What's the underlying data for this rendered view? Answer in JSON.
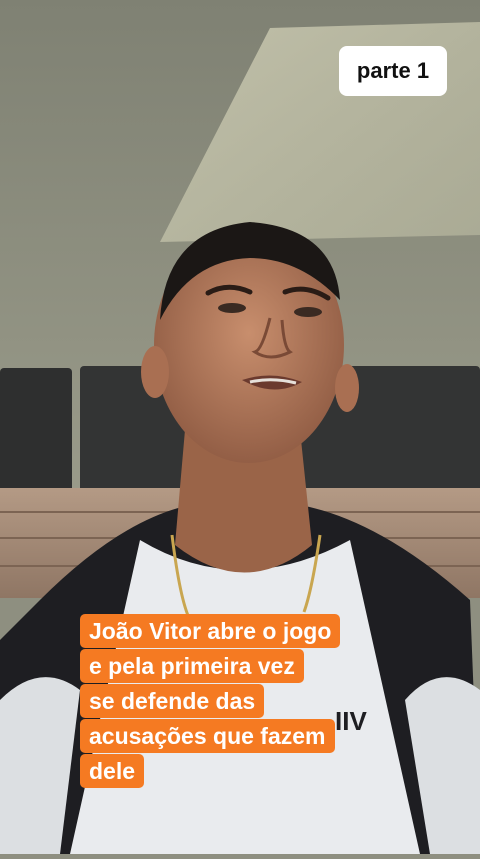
{
  "overlay": {
    "part_label": "parte 1",
    "caption_lines": [
      "João Vitor abre o jogo",
      "e pela primeira vez",
      "se defende das",
      "acusações que fazem",
      "dele"
    ],
    "caption_color": "#f57a22",
    "badge_color": "#ffffff"
  },
  "photo": {
    "subject": "young man in white jersey looking upward",
    "jersey_logo_text": "IIV"
  }
}
